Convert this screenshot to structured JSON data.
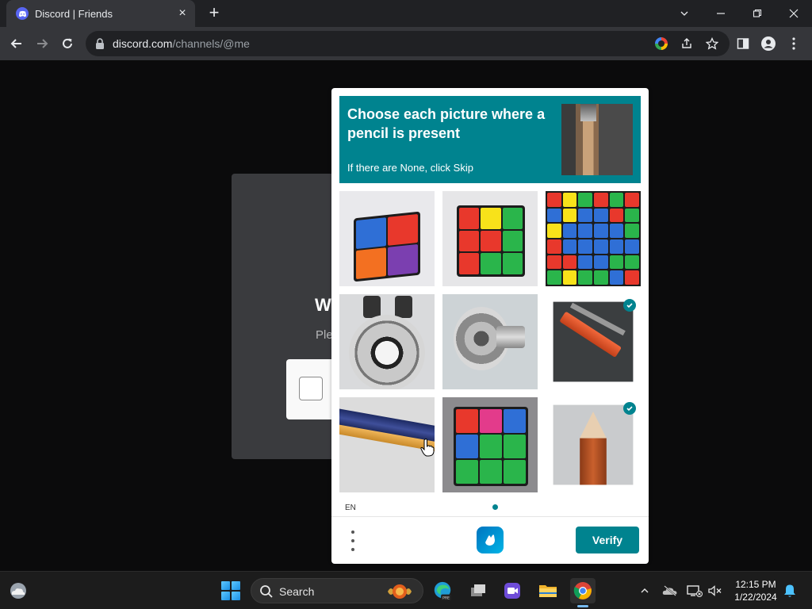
{
  "browser": {
    "tab_title": "Discord | Friends",
    "new_tab_symbol": "+",
    "tab_close_symbol": "×",
    "url_host": "discord.com",
    "url_path": "/channels/@me"
  },
  "discord": {
    "heading_partial": "W",
    "sub_partial": "Ple"
  },
  "captcha": {
    "prompt": "Choose each picture where a pencil is present",
    "instruction": "If there are None, click Skip",
    "accent_color": "#00838f",
    "tiles": [
      {
        "subject": "rubiks-cube-2x2",
        "selected": false
      },
      {
        "subject": "rubiks-cube-3x3",
        "selected": false
      },
      {
        "subject": "rubiks-cube-closeup",
        "selected": false
      },
      {
        "subject": "dumbbell-weight",
        "selected": false
      },
      {
        "subject": "dumbbell",
        "selected": false
      },
      {
        "subject": "pencil",
        "selected": true
      },
      {
        "subject": "pencil",
        "selected": false
      },
      {
        "subject": "rubiks-cube-3x3",
        "selected": false
      },
      {
        "subject": "pencil-tip",
        "selected": true
      }
    ],
    "language": "EN",
    "page_indicator": "1 of 1",
    "verify_label": "Verify"
  },
  "taskbar": {
    "search_label": "Search",
    "time": "12:15 PM",
    "date": "1/22/2024"
  }
}
